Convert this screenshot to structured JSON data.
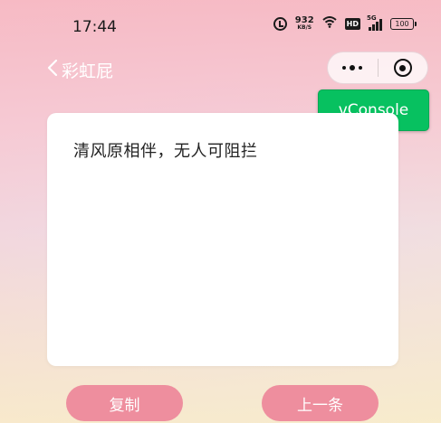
{
  "status_bar": {
    "time": "17:44",
    "speed_value": "932",
    "speed_unit": "KB/S",
    "hd_label": "HD",
    "network_label": "5G",
    "battery": "100"
  },
  "nav": {
    "back_icon": "chevron-left-icon",
    "title": "彩虹屁"
  },
  "capsule": {
    "more_icon": "more-dots-icon",
    "close_icon": "target-close-icon"
  },
  "vconsole": {
    "label": "vConsole"
  },
  "card": {
    "text": "清风原相伴，无人可阻拦"
  },
  "buttons": {
    "copy": "复制",
    "previous": "上一条"
  },
  "colors": {
    "accent_button": "#ee8e9e",
    "vconsole_green": "#07c160",
    "card_bg": "#ffffff"
  }
}
